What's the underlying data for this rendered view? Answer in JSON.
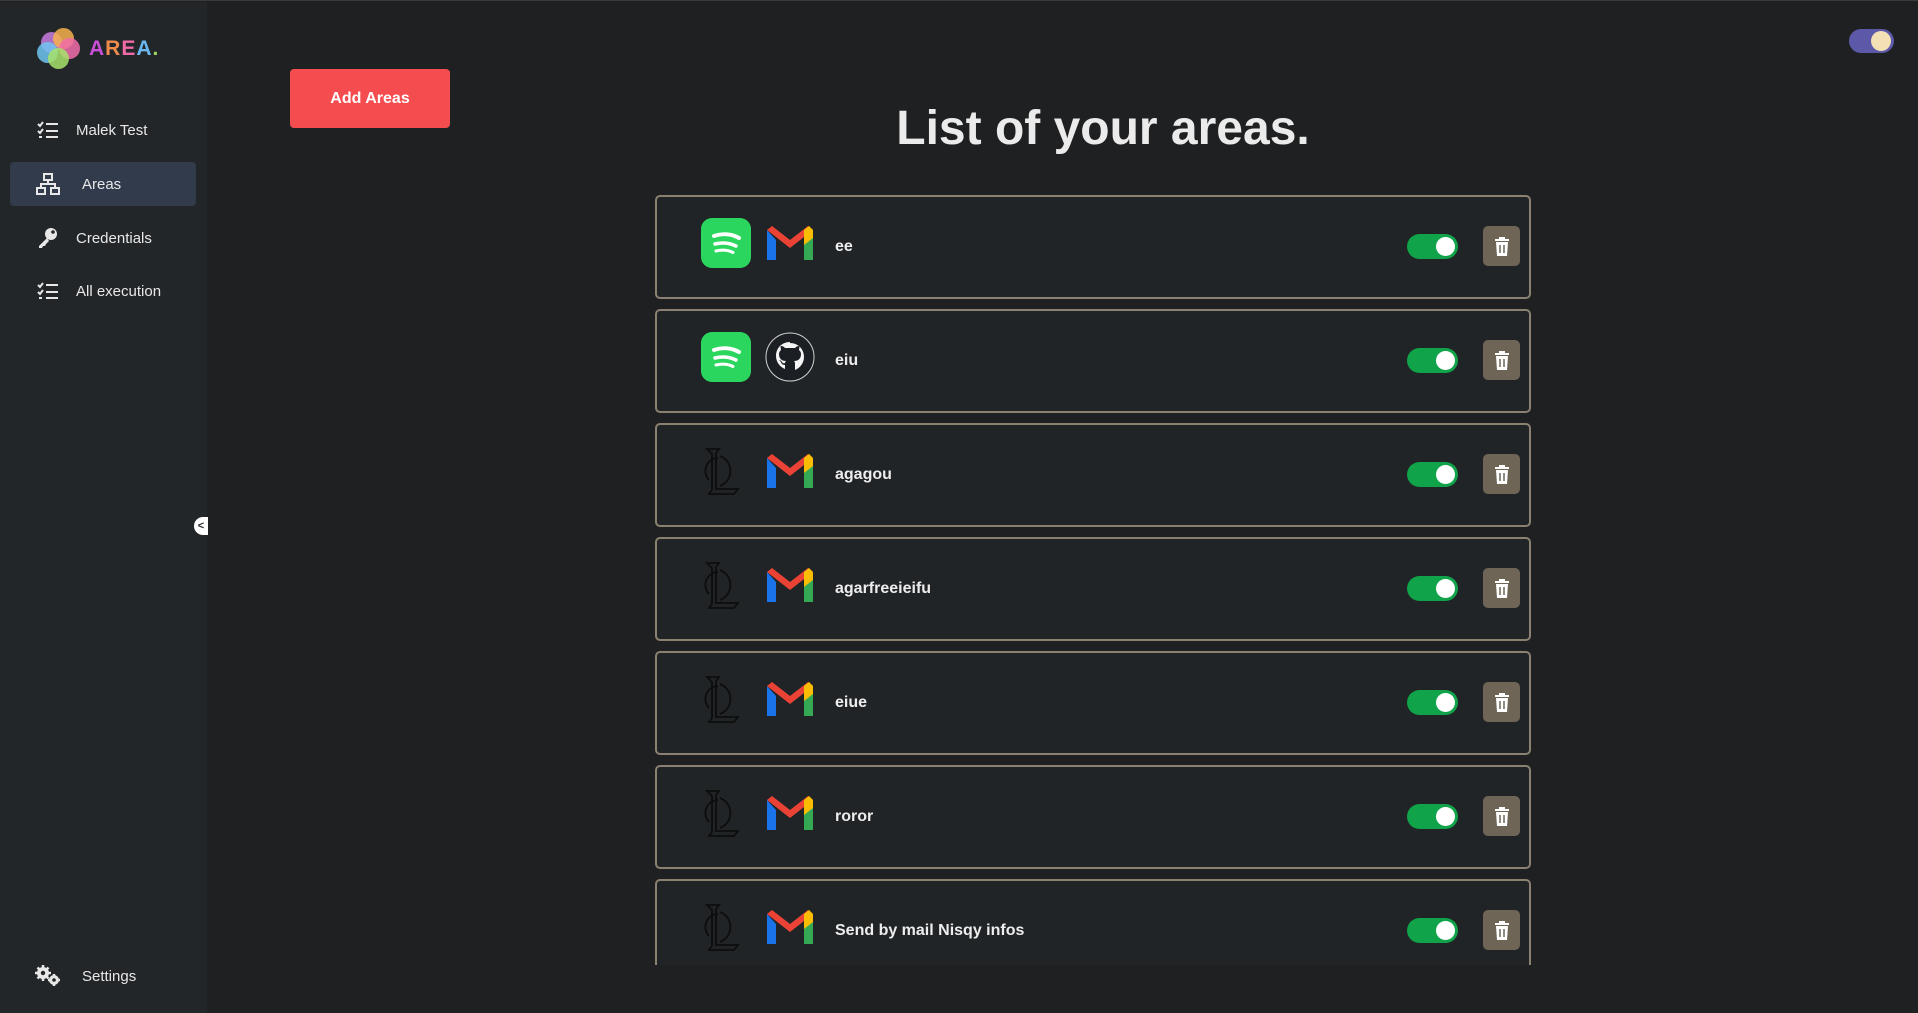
{
  "app": {
    "logo_text": "AREA."
  },
  "sidebar": {
    "items": [
      {
        "label": "Malek Test",
        "icon": "list-check-icon"
      },
      {
        "label": "Areas",
        "icon": "sitemap-icon",
        "active": true
      },
      {
        "label": "Credentials",
        "icon": "key-icon"
      },
      {
        "label": "All execution",
        "icon": "list-check-icon"
      }
    ],
    "settings": {
      "label": "Settings",
      "icon": "gears-icon"
    },
    "collapse_glyph": "<"
  },
  "header": {
    "add_button_label": "Add Areas",
    "theme_toggle": "moon-icon"
  },
  "main": {
    "title": "List of your areas.",
    "areas": [
      {
        "name": "ee",
        "action_service": "spotify",
        "reaction_service": "gmail",
        "enabled": true
      },
      {
        "name": "eiu",
        "action_service": "spotify",
        "reaction_service": "github",
        "enabled": true
      },
      {
        "name": "agagou",
        "action_service": "league-of-legends",
        "reaction_service": "gmail",
        "enabled": true
      },
      {
        "name": "agarfreeieifu",
        "action_service": "league-of-legends",
        "reaction_service": "gmail",
        "enabled": true
      },
      {
        "name": "eiue",
        "action_service": "league-of-legends",
        "reaction_service": "gmail",
        "enabled": true
      },
      {
        "name": "roror",
        "action_service": "league-of-legends",
        "reaction_service": "gmail",
        "enabled": true
      },
      {
        "name": "Send by mail Nisqy infos",
        "action_service": "league-of-legends",
        "reaction_service": "gmail",
        "enabled": true
      }
    ]
  },
  "colors": {
    "accent_red": "#f54d4f",
    "toggle_on": "#10a34a",
    "sidebar_active": "#323b4c",
    "row_border": "#8a8171"
  }
}
